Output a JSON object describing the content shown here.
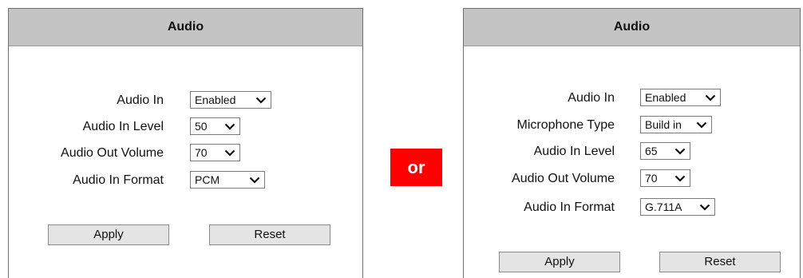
{
  "left_panel": {
    "title": "Audio",
    "audio_in": {
      "label": "Audio In",
      "value": "Enabled"
    },
    "audio_in_level": {
      "label": "Audio In Level",
      "value": "50"
    },
    "audio_out_volume": {
      "label": "Audio Out Volume",
      "value": "70"
    },
    "audio_in_format": {
      "label": "Audio In Format",
      "value": "PCM"
    },
    "apply_label": "Apply",
    "reset_label": "Reset"
  },
  "divider": {
    "text": "or",
    "color": "#ff0000"
  },
  "right_panel": {
    "title": "Audio",
    "audio_in": {
      "label": "Audio In",
      "value": "Enabled"
    },
    "microphone_type": {
      "label": "Microphone Type",
      "value": "Build in"
    },
    "audio_in_level": {
      "label": "Audio In Level",
      "value": "65"
    },
    "audio_out_volume": {
      "label": "Audio Out Volume",
      "value": "70"
    },
    "audio_in_format": {
      "label": "Audio In Format",
      "value": "G.711A"
    },
    "apply_label": "Apply",
    "reset_label": "Reset"
  },
  "icons": {
    "dropdown": "chevron-down-icon"
  },
  "colors": {
    "header_bg": "#c4c4c4",
    "button_bg": "#e4e4e4"
  }
}
